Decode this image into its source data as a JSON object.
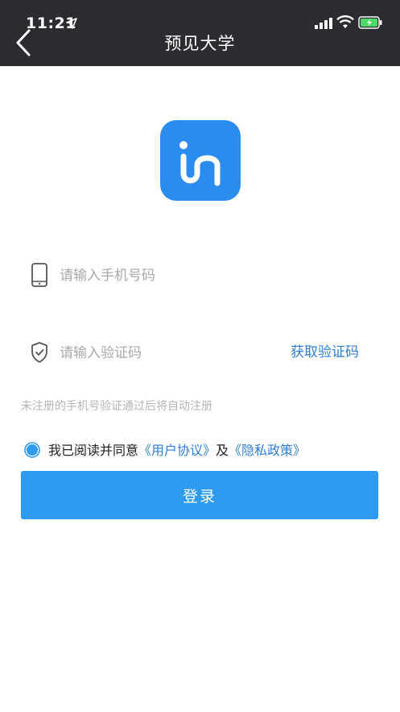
{
  "status_bar": {
    "time": "11:21"
  },
  "nav": {
    "title": "预见大学"
  },
  "login_form": {
    "phone_placeholder": "请输入手机号码",
    "code_placeholder": "请输入验证码",
    "get_code_label": "获取验证码",
    "hint": "未注册的手机号验证通过后将自动注册",
    "agree_prefix": "我已阅读并同意",
    "user_agreement": "《用户协议》",
    "and_text": "及",
    "privacy_policy": "《隐私政策》",
    "login_label": "登录"
  },
  "colors": {
    "nav_bg": "#2b2c30",
    "logo_bg": "#2b8cf0",
    "accent": "#2e9bf0",
    "link": "#2f7ed8"
  },
  "icons": [
    "location-arrow-icon",
    "signal-icon",
    "wifi-icon",
    "battery-icon",
    "chevron-left-icon",
    "phone-icon",
    "shield-check-icon",
    "app-logo"
  ]
}
